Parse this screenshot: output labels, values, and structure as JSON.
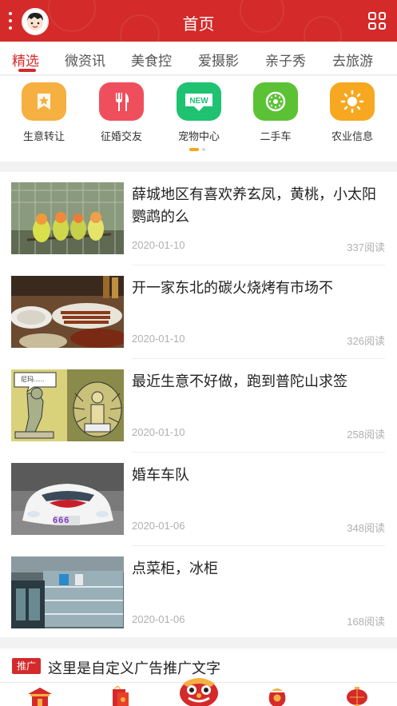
{
  "header": {
    "title": "首页"
  },
  "tabs": [
    {
      "label": "精选",
      "active": true
    },
    {
      "label": "微资讯"
    },
    {
      "label": "美食控"
    },
    {
      "label": "爱摄影"
    },
    {
      "label": "亲子秀"
    },
    {
      "label": "去旅游"
    }
  ],
  "categories": [
    {
      "label": "生意转让",
      "icon": "star-tag-icon",
      "color": "#f5b041"
    },
    {
      "label": "征婚交友",
      "icon": "fork-knife-icon",
      "color": "#ef4f5c"
    },
    {
      "label": "宠物中心",
      "icon": "new-badge-icon",
      "badge": "NEW",
      "color": "#1ec271"
    },
    {
      "label": "二手车",
      "icon": "kiwi-icon",
      "color": "#5bc236"
    },
    {
      "label": "农业信息",
      "icon": "sun-icon",
      "color": "#f7a820"
    }
  ],
  "news": [
    {
      "title": "薛城地区有喜欢养玄凤，黄桃，小太阳鹦鹉的么",
      "date": "2020-01-10",
      "views": "337阅读",
      "thumb": "parrots-photo"
    },
    {
      "title": "开一家东北的碳火烧烤有市场不",
      "date": "2020-01-10",
      "views": "326阅读",
      "thumb": "bbq-photo"
    },
    {
      "title": "最近生意不好做，跑到普陀山求签",
      "date": "2020-01-10",
      "views": "258阅读",
      "thumb": "cartoon-photo",
      "bubble": "尼玛......"
    },
    {
      "title": "婚车车队",
      "date": "2020-01-06",
      "views": "348阅读",
      "thumb": "wedding-car-photo",
      "plate": "666"
    },
    {
      "title": "点菜柜，冰柜",
      "date": "2020-01-06",
      "views": "168阅读",
      "thumb": "fridge-photo"
    }
  ],
  "promo": {
    "badge": "推广",
    "text": "这里是自定义广告推广文字"
  },
  "colors": {
    "brand": "#d42a2a",
    "pager_active": "#f5a623"
  }
}
